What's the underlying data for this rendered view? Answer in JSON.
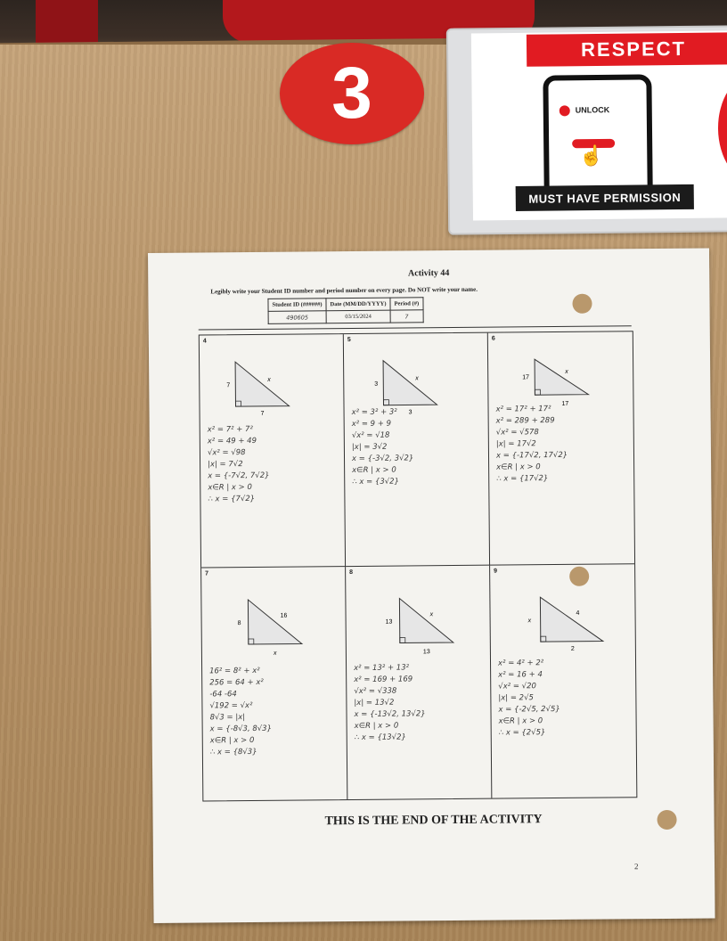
{
  "sticker": {
    "number": "3"
  },
  "sign": {
    "banner": "RESPECT",
    "phone_label": "UNLOCK",
    "footer": "MUST HAVE PERMISSION",
    "accent": "#e11b22"
  },
  "worksheet": {
    "title": "Activity 44",
    "instructions": "Legibly write your Student ID number and period number on every page. Do NOT write your name.",
    "id_table": {
      "headers": [
        "Student ID (######)",
        "Date (MM/DD/YYYY)",
        "Period (#)"
      ],
      "values": [
        "490605",
        "03/15/2024",
        "7"
      ]
    },
    "problems": [
      {
        "number": "4",
        "labels": {
          "a": "7",
          "b": "7",
          "c": "x"
        },
        "work": [
          "x² = 7² + 7²",
          "x² = 49 + 49",
          "√x² = √98",
          "|x| = 7√2",
          "x = {-7√2, 7√2}",
          "x∈R | x > 0",
          "∴ x = {7√2}"
        ]
      },
      {
        "number": "5",
        "labels": {
          "a": "3",
          "b": "3",
          "c": "x"
        },
        "work": [
          "x² = 3² + 3²",
          "x² = 9 + 9",
          "√x² = √18",
          "|x| = 3√2",
          "x = {-3√2, 3√2}",
          "x∈R | x > 0",
          "∴ x = {3√2}"
        ]
      },
      {
        "number": "6",
        "labels": {
          "a": "17",
          "b": "17",
          "c": "x"
        },
        "work": [
          "x² = 17² + 17²",
          "x² = 289 + 289",
          "√x² = √578",
          "|x| = 17√2",
          "x = {-17√2, 17√2}",
          "x∈R | x > 0",
          "∴ x = {17√2}"
        ]
      },
      {
        "number": "7",
        "labels": {
          "a": "8",
          "b": "x",
          "c": "16"
        },
        "work": [
          "16² = 8² + x²",
          "256 = 64 + x²",
          "-64   -64",
          "√192 = √x²",
          "8√3 = |x|",
          "x = {-8√3, 8√3}",
          "x∈R | x > 0",
          "∴ x = {8√3}"
        ]
      },
      {
        "number": "8",
        "labels": {
          "a": "13",
          "b": "13",
          "c": "x"
        },
        "work": [
          "x² = 13² + 13²",
          "x² = 169 + 169",
          "√x² = √338",
          "|x| = 13√2",
          "x = {-13√2, 13√2}",
          "x∈R | x > 0",
          "∴ x = {13√2}"
        ]
      },
      {
        "number": "9",
        "labels": {
          "a": "x",
          "b": "2",
          "c": "4"
        },
        "work": [
          "x² = 4² + 2²",
          "x² = 16 + 4",
          "√x² = √20",
          "|x| = 2√5",
          "x = {-2√5, 2√5}",
          "x∈R | x > 0",
          "∴ x = {2√5}"
        ]
      }
    ],
    "end_text": "THIS IS THE END OF THE ACTIVITY",
    "page_number": "2"
  }
}
